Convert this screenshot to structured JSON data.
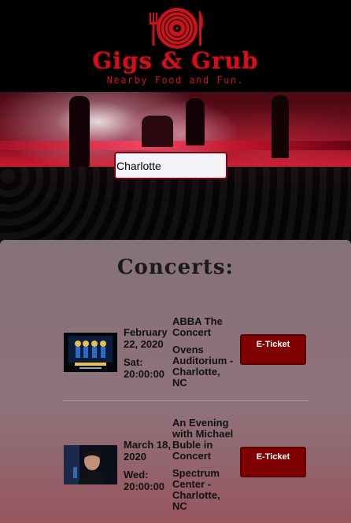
{
  "header": {
    "brand": "Gigs & Grub",
    "tagline": "Nearby Food and Fun."
  },
  "search": {
    "value": "Charlotte",
    "placeholder": ""
  },
  "concerts_section": {
    "title": "Concerts:",
    "items": [
      {
        "date": "February 22, 2020",
        "day": "Sat: 20:00:00",
        "name": "ABBA The Concert",
        "venue": "Ovens Auditorium - Charlotte, NC",
        "ticket_label": "E-Ticket"
      },
      {
        "date": "March 18, 2020",
        "day": "Wed: 20:00:00",
        "name": "An Evening with Michael Buble in Concert",
        "venue": "Spectrum Center - Charlotte, NC",
        "ticket_label": "E-Ticket"
      }
    ]
  },
  "colors": {
    "brand_red": "#d0101a",
    "ticket_button": "#800000"
  }
}
